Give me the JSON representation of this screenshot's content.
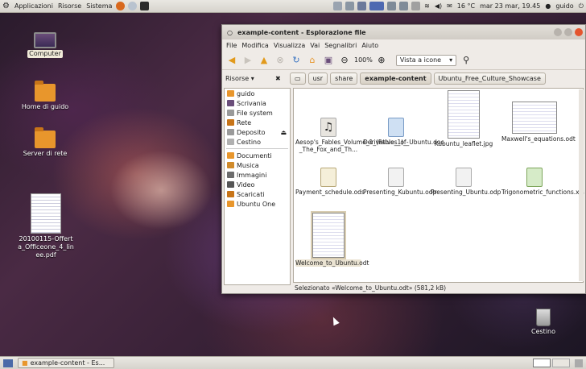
{
  "top_panel": {
    "menus": [
      "Applicazioni",
      "Risorse",
      "Sistema"
    ],
    "weather": "16 °C",
    "clock": "mar 23 mar, 19.45",
    "user": "guido"
  },
  "desktop_icons": [
    {
      "label": "Computer",
      "icon": "computer-icon"
    },
    {
      "label": "Home di guido",
      "icon": "home-folder-icon"
    },
    {
      "label": "Server di rete",
      "icon": "network-folder-icon"
    },
    {
      "label": "20100115-Offerta_Officeone_4_linee.pdf",
      "icon": "pdf-thumbnail"
    },
    {
      "label": "Cestino",
      "icon": "trash-icon"
    }
  ],
  "window": {
    "title": "example-content - Esplorazione file",
    "menubar": [
      "File",
      "Modifica",
      "Visualizza",
      "Vai",
      "Segnalibri",
      "Aiuto"
    ],
    "zoom": "100%",
    "view_mode": "Vista a icone",
    "sidebar_header": "Risorse",
    "path": [
      "usr",
      "share",
      "example-content",
      "Ubuntu_Free_Culture_Showcase"
    ],
    "sidebar": {
      "places": [
        "guido",
        "Scrivania",
        "File system",
        "Rete",
        "Deposito",
        "Cestino"
      ],
      "bookmarks": [
        "Documenti",
        "Musica",
        "Immagini",
        "Video",
        "Scaricati",
        "Ubuntu One"
      ]
    },
    "files": [
      {
        "name": "Aesop's_Fables_Volume_1_(Fable_1)_-_The_Fox_and_Th...",
        "type": "audio"
      },
      {
        "name": "Derivatives_of_Ubuntu.doc",
        "type": "doc"
      },
      {
        "name": "Kubuntu_leaflet.jpg",
        "type": "image"
      },
      {
        "name": "Maxwell's_equations.odt",
        "type": "odt"
      },
      {
        "name": "Payment_schedule.ods",
        "type": "ods"
      },
      {
        "name": "Presenting_Kubuntu.odp",
        "type": "odp"
      },
      {
        "name": "Presenting_Ubuntu.odp",
        "type": "odp"
      },
      {
        "name": "Trigonometric_functions.xls",
        "type": "xls"
      },
      {
        "name": "Welcome_to_Ubuntu.odt",
        "type": "odt",
        "selected": true
      }
    ],
    "status": "Selezionato «Welcome_to_Ubuntu.odt» (581,2 kB)"
  },
  "taskbar": {
    "task": "example-content - Es..."
  }
}
